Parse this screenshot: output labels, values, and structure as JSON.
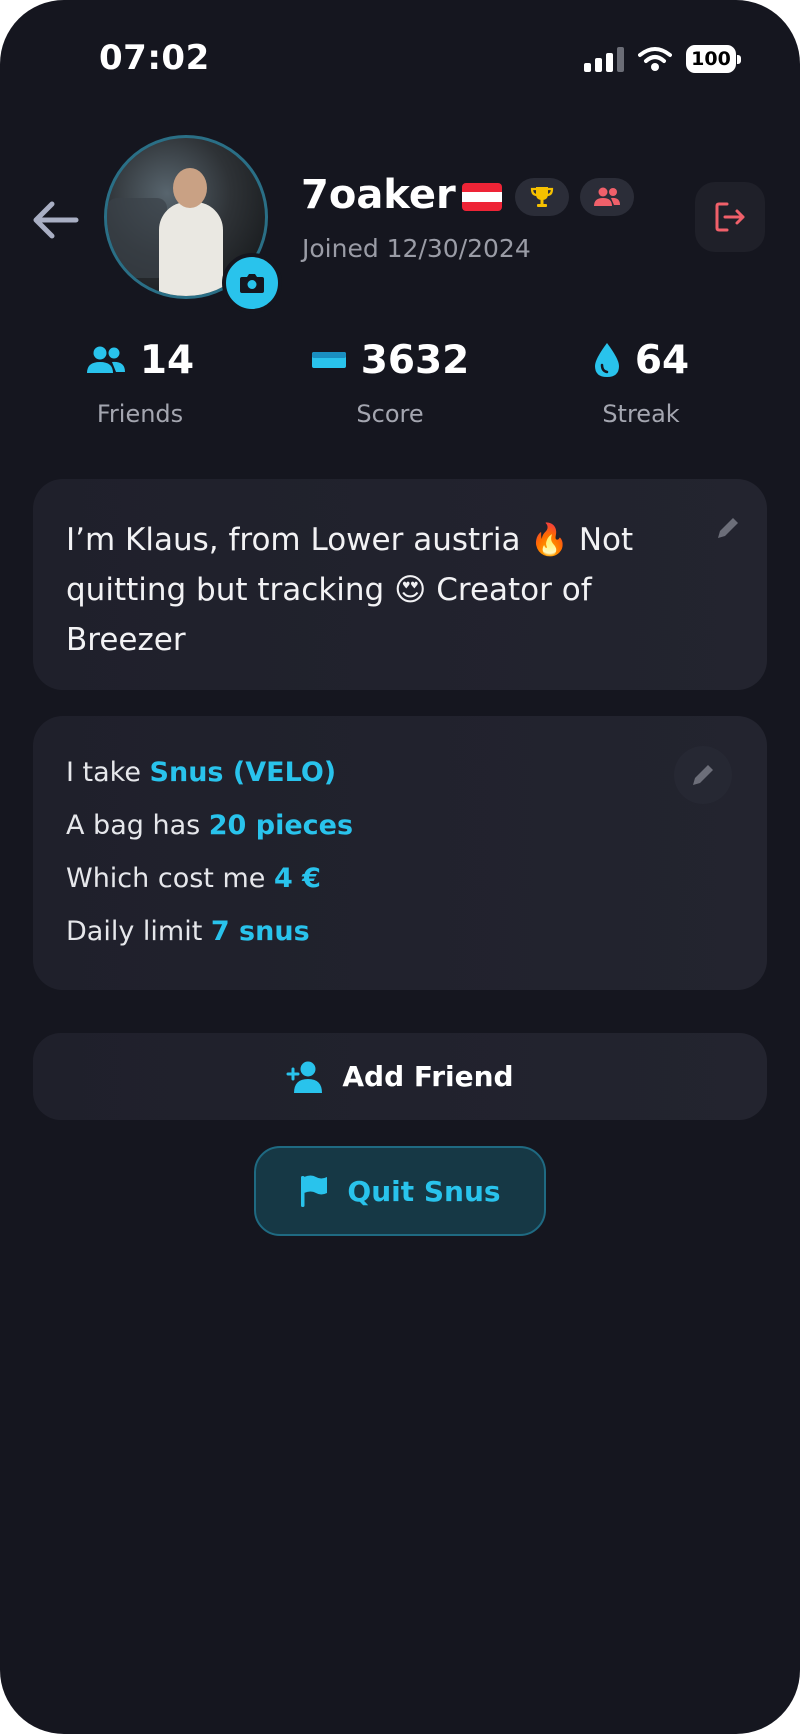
{
  "status_bar": {
    "time": "07:02",
    "battery": "100"
  },
  "profile": {
    "username": "7oaker",
    "joined": "Joined 12/30/2024",
    "country_flag": "Austria"
  },
  "stats": [
    {
      "value": "14",
      "label": "Friends",
      "icon": "users-icon"
    },
    {
      "value": "3632",
      "label": "Score",
      "icon": "score-bar-icon"
    },
    {
      "value": "64",
      "label": "Streak",
      "icon": "drop-icon"
    }
  ],
  "bio": {
    "line1_pre": "I’m Klaus, from Lower austria ",
    "emoji_fire": "🔥",
    "line1_post": " Not quitting but tracking ",
    "emoji_love": "😍",
    "line2_post": " Creator of Breezer"
  },
  "usage": {
    "take_label": "I take ",
    "take_value": "Snus (VELO)",
    "bag_label": "A bag has ",
    "bag_value": "20 pieces",
    "cost_label": "Which cost me ",
    "cost_value": "4 €",
    "limit_label": "Daily limit ",
    "limit_value": "7 snus"
  },
  "actions": {
    "add_friend": "Add Friend",
    "quit": "Quit Snus"
  },
  "colors": {
    "background": "#15161f",
    "accent": "#29c3ec",
    "card": "#1f202b",
    "danger": "#f0606a"
  }
}
